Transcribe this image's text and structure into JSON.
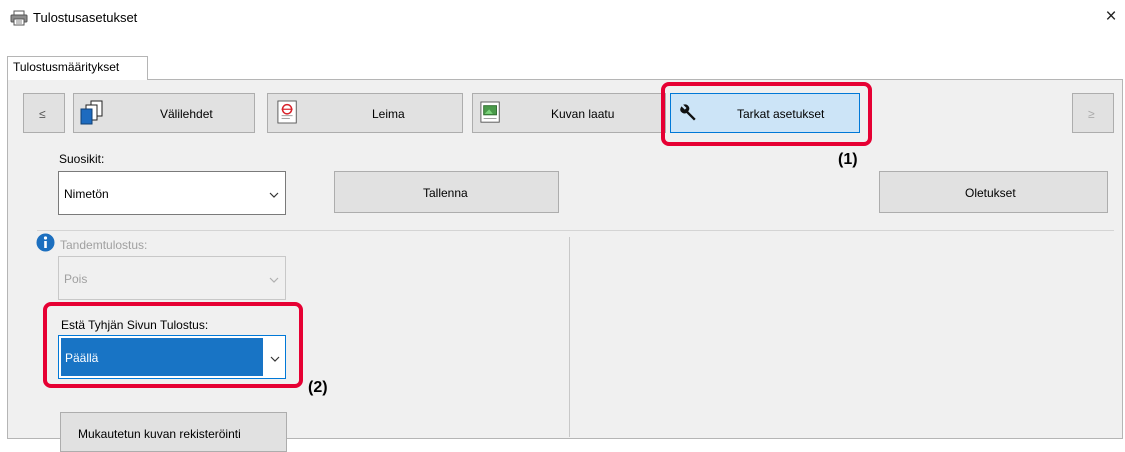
{
  "window": {
    "title": "Tulostusasetukset",
    "close_glyph": "×",
    "icon": "printer-icon"
  },
  "tabs": [
    {
      "label": "Tulostusmääritykset",
      "active": true
    }
  ],
  "pagebar": {
    "prev_label": "≤",
    "next_label": "≥",
    "buttons": [
      {
        "label": "Välilehdet",
        "icon": "tab-pages-icon"
      },
      {
        "label": "Leima",
        "icon": "stamp-icon"
      },
      {
        "label": "Kuvan laatu",
        "icon": "image-quality-icon"
      },
      {
        "label": "Tarkat asetukset",
        "icon": "wrench-icon",
        "selected": true
      }
    ]
  },
  "favorites": {
    "label": "Suosikit:",
    "value": "Nimetön",
    "save_label": "Tallenna",
    "defaults_label": "Oletukset"
  },
  "tandem": {
    "label": "Tandemtulostus:",
    "value": "Pois",
    "disabled": true,
    "info_icon": "info-icon"
  },
  "blank_page": {
    "label": "Estä Tyhjän Sivun Tulostus:",
    "value": "Päällä"
  },
  "custom_image_button": "Mukautetun kuvan rekisteröinti",
  "callouts": {
    "c1": "(1)",
    "c2": "(2)"
  },
  "colors": {
    "highlight": "#e60033",
    "selected_bg": "#1874c5",
    "selected_button_bg": "#cce4f7",
    "info_blue": "#1c6fbf"
  }
}
